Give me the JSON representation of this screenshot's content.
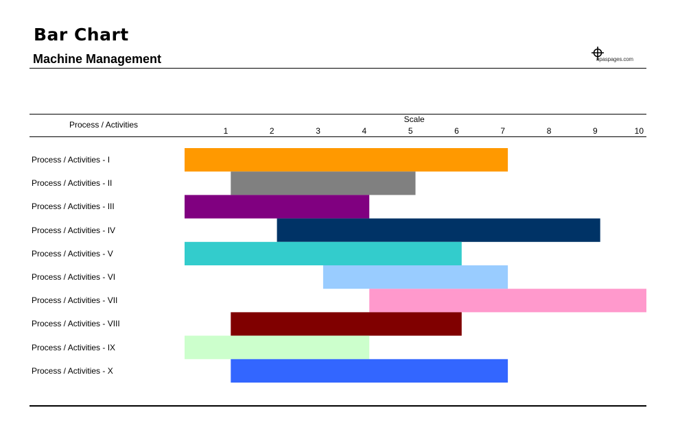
{
  "header": {
    "title": "Bar Chart",
    "subtitle": "Machine Management",
    "logo_text": "npaspages.com"
  },
  "chart_data": {
    "type": "bar",
    "orientation": "horizontal-range",
    "title": "Bar Chart",
    "subtitle": "Machine Management",
    "category_header": "Process / Activities",
    "xlabel": "Scale",
    "xlim": [
      1,
      10
    ],
    "ticks": [
      "1",
      "2",
      "3",
      "4",
      "5",
      "6",
      "7",
      "8",
      "9",
      "10"
    ],
    "grid": false,
    "categories": [
      "Process / Activities - I",
      "Process / Activities - II",
      "Process / Activities - III",
      "Process / Activities - IV",
      "Process / Activities - V",
      "Process / Activities - VI",
      "Process / Activities - VII",
      "Process / Activities - VIII",
      "Process / Activities - IX",
      "Process / Activities - X"
    ],
    "series": [
      {
        "name": "Process / Activities - I",
        "start": 1,
        "end": 7,
        "color": "#FF9900"
      },
      {
        "name": "Process / Activities - II",
        "start": 2,
        "end": 5,
        "color": "#808080"
      },
      {
        "name": "Process / Activities - III",
        "start": 1,
        "end": 4,
        "color": "#800080"
      },
      {
        "name": "Process / Activities - IV",
        "start": 3,
        "end": 9,
        "color": "#003366"
      },
      {
        "name": "Process / Activities - V",
        "start": 1,
        "end": 6,
        "color": "#33CCCC"
      },
      {
        "name": "Process / Activities - VI",
        "start": 4,
        "end": 7,
        "color": "#99CCFF"
      },
      {
        "name": "Process / Activities - VII",
        "start": 5,
        "end": 10,
        "color": "#FF99CC"
      },
      {
        "name": "Process / Activities - VIII",
        "start": 2,
        "end": 6,
        "color": "#800000"
      },
      {
        "name": "Process / Activities - IX",
        "start": 1,
        "end": 4,
        "color": "#CCFFCC"
      },
      {
        "name": "Process / Activities - X",
        "start": 2,
        "end": 7,
        "color": "#3366FF"
      }
    ]
  }
}
